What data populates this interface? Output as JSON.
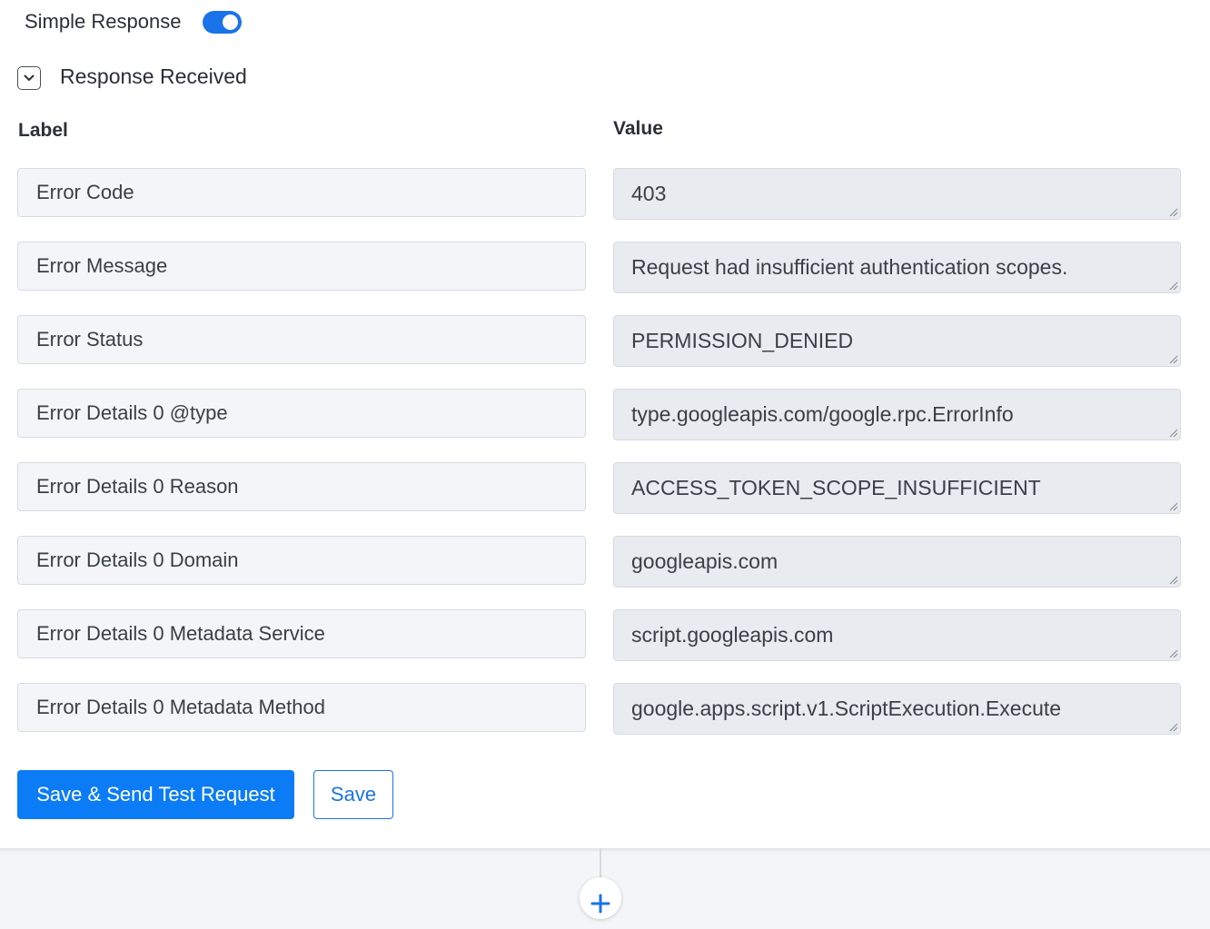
{
  "simple_response": {
    "label": "Simple Response",
    "enabled": true
  },
  "section": {
    "title": "Response Received",
    "expanded": true
  },
  "columns": {
    "label": "Label",
    "value": "Value"
  },
  "rows": [
    {
      "label": "Error Code",
      "value": "403"
    },
    {
      "label": "Error Message",
      "value": "Request had insufficient authentication scopes."
    },
    {
      "label": "Error Status",
      "value": "PERMISSION_DENIED"
    },
    {
      "label": "Error Details 0 @type",
      "value": "type.googleapis.com/google.rpc.ErrorInfo"
    },
    {
      "label": "Error Details 0 Reason",
      "value": "ACCESS_TOKEN_SCOPE_INSUFFICIENT"
    },
    {
      "label": "Error Details 0 Domain",
      "value": "googleapis.com"
    },
    {
      "label": "Error Details 0 Metadata Service",
      "value": "script.googleapis.com"
    },
    {
      "label": "Error Details 0 Metadata Method",
      "value": "google.apps.script.v1.ScriptExecution.Execute"
    }
  ],
  "actions": {
    "save_and_test": "Save & Send Test Request",
    "save": "Save"
  },
  "icons": {
    "toggle": "toggle-on-icon",
    "collapse": "chevron-down-icon",
    "resize": "resize-grip-icon",
    "add": "plus-icon"
  },
  "colors": {
    "accent": "#0b7cf5",
    "label_bg": "#f3f5f8",
    "value_bg": "#e8ebef"
  }
}
